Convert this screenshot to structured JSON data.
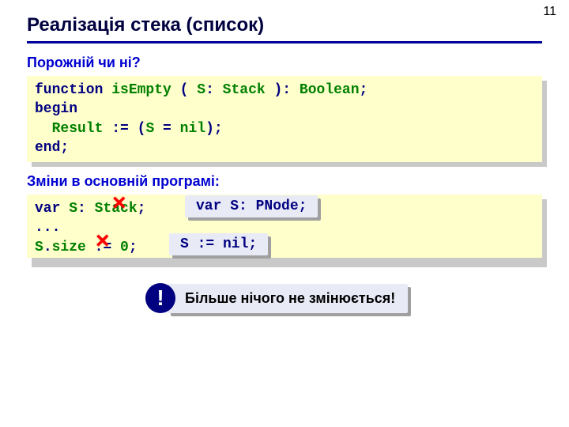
{
  "page_number": "11",
  "title": "Реалізація стека (список)",
  "section1_heading": "Порожній чи ні?",
  "code1": {
    "l1_a": "function",
    "l1_b": " isEmpty ",
    "l1_c": "(",
    "l1_d": " S",
    "l1_e": ":",
    "l1_f": " Stack ",
    "l1_g": "):",
    "l1_h": " Boolean",
    "l1_i": ";",
    "l2": "begin",
    "l3_a": "  Result ",
    "l3_b": ":= (",
    "l3_c": "S ",
    "l3_d": "=",
    "l3_e": " nil",
    "l3_f": ");",
    "l4_a": "end",
    "l4_b": ";"
  },
  "section2_heading": "Зміни в основній програмі:",
  "code2": {
    "l1_a": "var",
    "l1_b": " S",
    "l1_c": ":",
    "l1_d": " Stack",
    "l1_e": ";",
    "l2": "...",
    "l3_a": "S",
    "l3_b": ".",
    "l3_c": "size ",
    "l3_d": ":=",
    "l3_e": " 0",
    "l3_f": ";"
  },
  "callout1": "var S: PNode;",
  "callout2": "S := nil;",
  "cross": "×",
  "note_mark": "!",
  "note_text": "Більше нічого не змінюється!"
}
